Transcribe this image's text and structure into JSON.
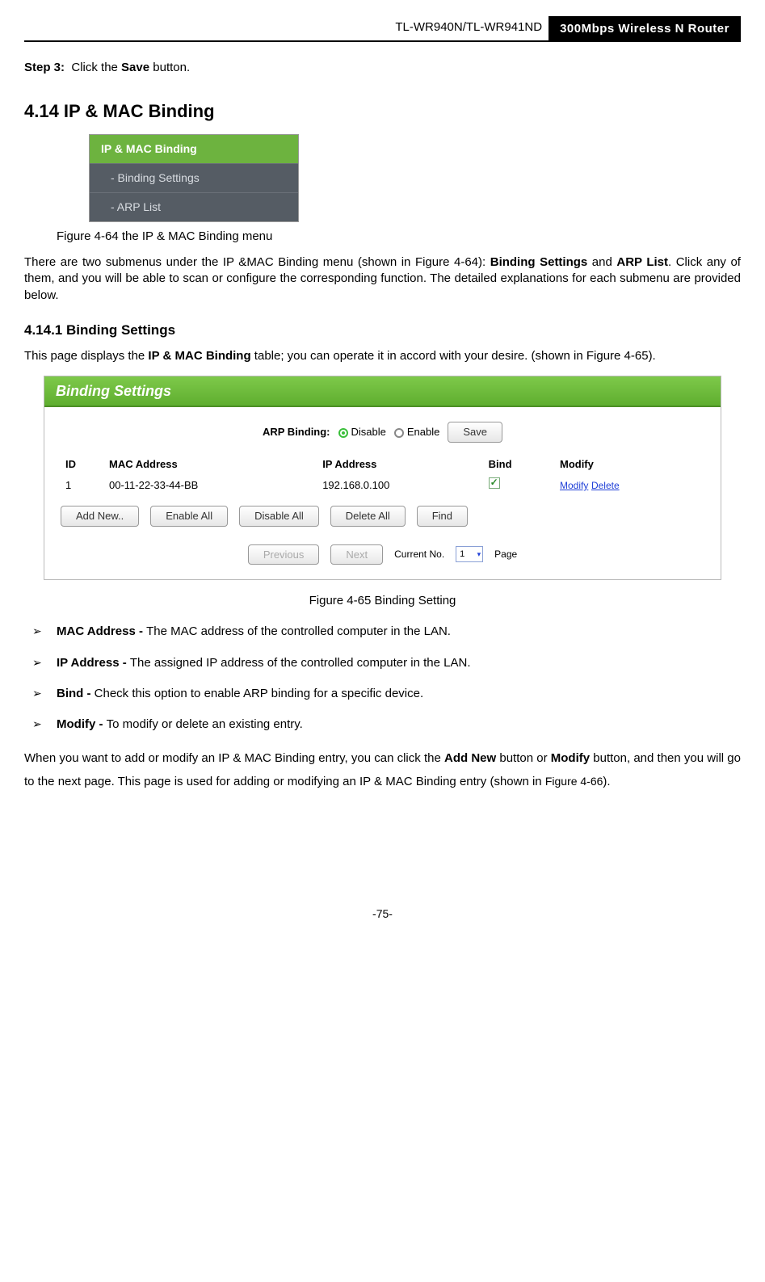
{
  "header": {
    "left": "TL-WR940N/TL-WR941ND",
    "right": "300Mbps Wireless N Router"
  },
  "step3": {
    "label": "Step 3:",
    "before": "Click the ",
    "bold": "Save",
    "after": " button."
  },
  "section_title": "4.14  IP & MAC Binding",
  "menu": {
    "header": "IP & MAC Binding",
    "items": [
      "- Binding Settings",
      "- ARP List"
    ]
  },
  "fig64": "Figure 4-64 the IP & MAC Binding menu",
  "para1": {
    "a": "There are two submenus under the IP &MAC Binding menu (shown in Figure 4-64): ",
    "b1": "Binding Settings",
    "mid": " and ",
    "b2": "ARP List",
    "c": ". Click any of them, and you will be able to scan or configure the corresponding function. The detailed explanations for each submenu are provided below."
  },
  "subsection_title": "4.14.1 Binding Settings",
  "para2": {
    "a": "This page displays the ",
    "b": "IP & MAC Binding",
    "c": " table; you can operate it in accord with your desire. (shown in Figure 4-65)."
  },
  "panel": {
    "title": "Binding Settings",
    "arp_label": "ARP Binding:",
    "radio_disable": "Disable",
    "radio_enable": "Enable",
    "save": "Save",
    "columns": {
      "id": "ID",
      "mac": "MAC Address",
      "ip": "IP Address",
      "bind": "Bind",
      "modify": "Modify"
    },
    "row": {
      "id": "1",
      "mac": "00-11-22-33-44-BB",
      "ip": "192.168.0.100",
      "modify": "Modify",
      "delete": "Delete"
    },
    "buttons": {
      "add": "Add New..",
      "enable": "Enable All",
      "disable": "Disable All",
      "delete": "Delete All",
      "find": "Find"
    },
    "pager": {
      "prev": "Previous",
      "next": "Next",
      "current_label": "Current No.",
      "page": "Page",
      "value": "1"
    }
  },
  "fig65": "Figure 4-65 Binding Setting",
  "bullets": [
    {
      "b": "MAC Address - ",
      "t": "The MAC address of the controlled computer in the LAN."
    },
    {
      "b": "IP Address - ",
      "t": "The assigned IP address of the controlled computer in the LAN."
    },
    {
      "b": "Bind - ",
      "t": "Check this option to enable ARP binding for a specific device."
    },
    {
      "b": "Modify - ",
      "t": "To modify or delete an existing entry."
    }
  ],
  "para3": {
    "a": "When you want to add or modify an IP & MAC Binding entry, you can click the ",
    "b1": "Add New",
    "mid1": " button or ",
    "b2": "Modify",
    "mid2": " button, and then you will go to the next page. This page is used for adding or modifying an IP & MAC Binding entry (shown in ",
    "fig": "Figure 4-66",
    "end": ")."
  },
  "footer": "-75-"
}
